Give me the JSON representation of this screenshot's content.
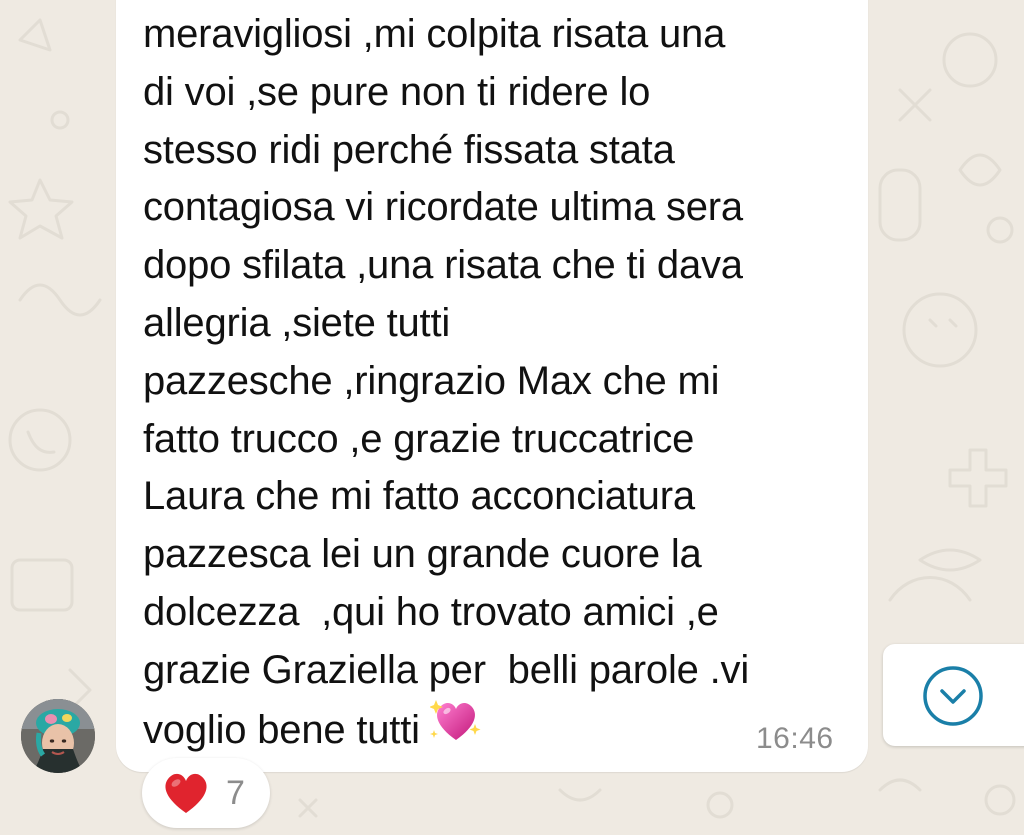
{
  "message": {
    "lines": [
      "meravigliosi ,mi colpita risata una",
      "di voi ,se pure non ti ridere lo",
      "stesso ridi perché fissata stata",
      "contagiosa vi ricordate ultima sera",
      "dopo sfilata ,una risata che ti dava",
      "allegria ,siete tutti",
      "pazzesche ,ringrazio Max che mi",
      "fatto trucco ,e grazie truccatrice",
      "Laura che mi fatto acconciatura",
      "pazzesca lei un grande cuore la",
      "dolcezza  ,qui ho trovato amici ,e",
      "grazie Graziella per  belli parole .vi",
      "voglio bene tutti"
    ],
    "trailing_emoji": "sparkling-heart",
    "time": "16:46"
  },
  "reaction": {
    "emoji": "red-heart",
    "count": "7"
  },
  "colors": {
    "wallpaper": "#efeae2",
    "bubble": "#ffffff",
    "text": "#111111",
    "timestamp": "#8c8c8c",
    "accent": "#1a7fa8",
    "heart": "#e0242e"
  }
}
